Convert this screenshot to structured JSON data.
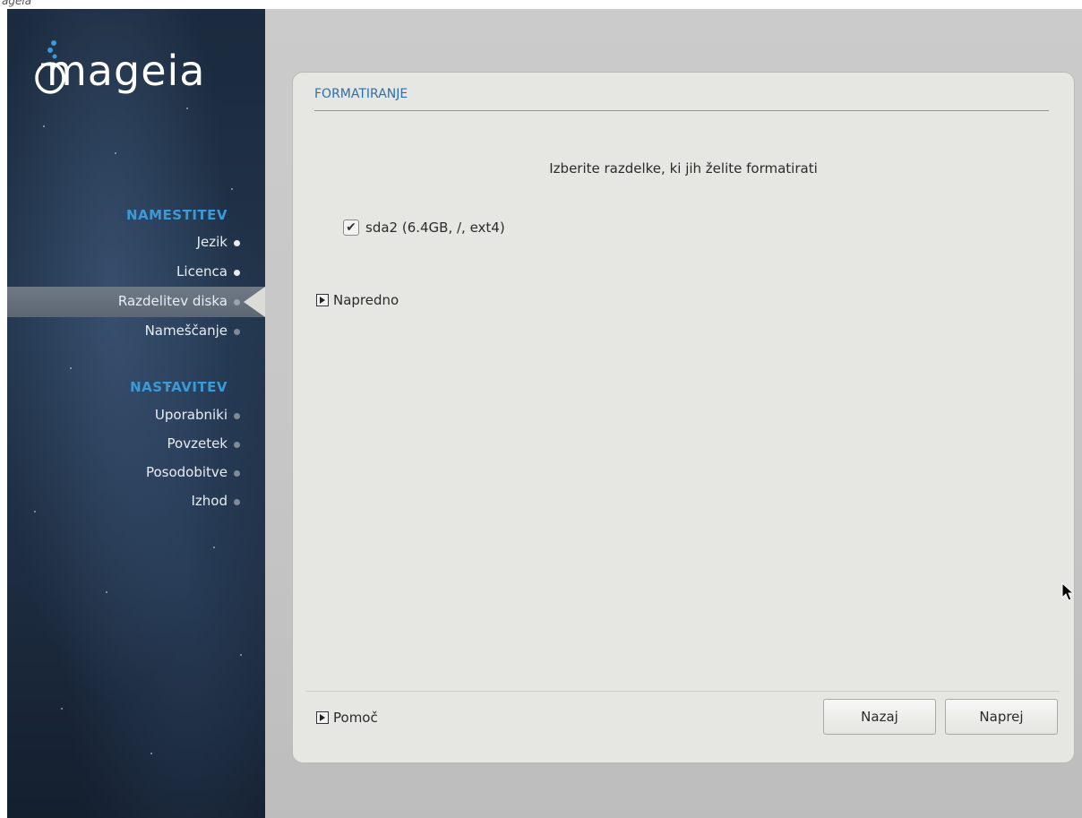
{
  "caption": "ageia",
  "sidebar": {
    "logo_text": "mageia",
    "sections": [
      {
        "title": "NAMESTITEV",
        "steps": [
          {
            "label": "Jezik",
            "state": "done"
          },
          {
            "label": "Licenca",
            "state": "done"
          },
          {
            "label": "Razdelitev diska",
            "state": "active"
          },
          {
            "label": "Nameščanje",
            "state": "todo"
          }
        ]
      },
      {
        "title": "NASTAVITEV",
        "steps": [
          {
            "label": "Uporabniki",
            "state": "todo"
          },
          {
            "label": "Povzetek",
            "state": "todo"
          },
          {
            "label": "Posodobitve",
            "state": "todo"
          },
          {
            "label": "Izhod",
            "state": "todo"
          }
        ]
      }
    ]
  },
  "panel": {
    "title": "FORMATIRANJE",
    "instruction": "Izberite razdelke, ki jih želite formatirati",
    "partition": {
      "label": "sda2 (6.4GB, /, ext4)",
      "checked": true
    },
    "advanced_label": "Napredno",
    "help_label": "Pomoč",
    "back_label": "Nazaj",
    "next_label": "Naprej"
  },
  "colors": {
    "accent": "#3a9ad9",
    "title": "#2d6fae",
    "panel_bg": "#e6e7e2"
  },
  "icons": {
    "check": "check-icon",
    "expander": "triangle-right-icon",
    "cursor": "mouse-pointer-icon",
    "logo": "mageia-logo-icon"
  }
}
